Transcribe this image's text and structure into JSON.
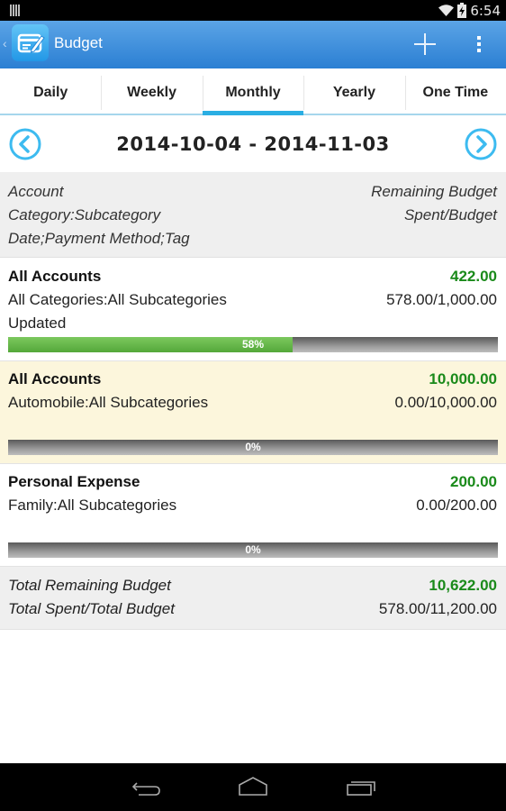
{
  "status_bar": {
    "time": "6:54",
    "icons": [
      "signal-bars-icon",
      "wifi-icon",
      "battery-charging-icon"
    ]
  },
  "action_bar": {
    "title": "Budget",
    "icons": [
      "back-caret-icon",
      "app-logo-icon",
      "add-icon",
      "overflow-menu-icon"
    ]
  },
  "tabs": [
    {
      "label": "Daily",
      "active": false
    },
    {
      "label": "Weekly",
      "active": false
    },
    {
      "label": "Monthly",
      "active": true
    },
    {
      "label": "Yearly",
      "active": false
    },
    {
      "label": "One Time",
      "active": false
    }
  ],
  "date_nav": {
    "range": "2014-10-04 - 2014-11-03",
    "prev_icon": "chevron-left-circle-icon",
    "next_icon": "chevron-right-circle-icon"
  },
  "legend": {
    "left": [
      "Account",
      "Category:Subcategory",
      "Date;Payment Method;Tag"
    ],
    "right": [
      "Remaining Budget",
      "Spent/Budget"
    ]
  },
  "budgets": [
    {
      "account": "All Accounts",
      "remaining": "422.00",
      "category": "All Categories:All Subcategories",
      "spent_budget": "578.00/1,000.00",
      "extra": "Updated",
      "progress_percent": 58,
      "progress_label": "58%",
      "highlighted": false
    },
    {
      "account": "All Accounts",
      "remaining": "10,000.00",
      "category": "Automobile:All Subcategories",
      "spent_budget": "0.00/10,000.00",
      "extra": "",
      "progress_percent": 0,
      "progress_label": "0%",
      "highlighted": true
    },
    {
      "account": "Personal Expense",
      "remaining": "200.00",
      "category": "Family:All Subcategories",
      "spent_budget": "0.00/200.00",
      "extra": "",
      "progress_percent": 0,
      "progress_label": "0%",
      "highlighted": false
    }
  ],
  "totals": {
    "remaining_label": "Total Remaining Budget",
    "remaining_value": "10,622.00",
    "spent_label": "Total Spent/Total Budget",
    "spent_value": "578.00/11,200.00"
  },
  "colors": {
    "action_bar_top": "#5ba4e6",
    "action_bar_bottom": "#2b7fd3",
    "tab_indicator": "#2aaee3",
    "positive_green": "#1a8a1a",
    "progress_green": "#6abf4b",
    "highlight_row": "#fcf6dc",
    "nav_circle": "#3dbbf0"
  },
  "nav_bar": {
    "icons": [
      "back-icon",
      "home-icon",
      "recent-apps-icon"
    ]
  }
}
